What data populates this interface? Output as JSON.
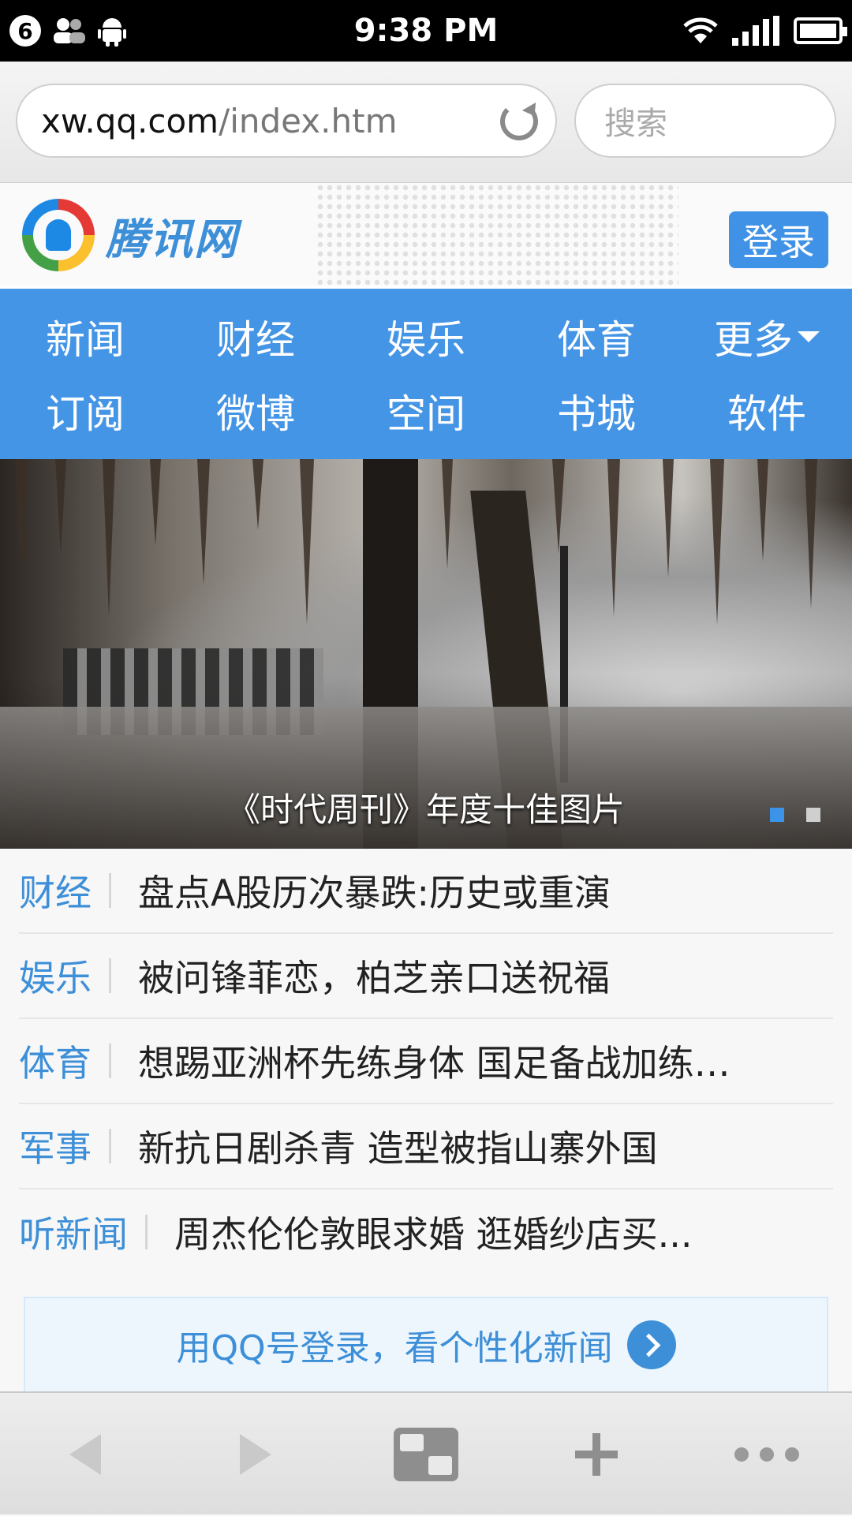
{
  "status_bar": {
    "notification_count": "6",
    "time": "9:38 PM"
  },
  "browser": {
    "url_host": "xw.qq.com",
    "url_path": "/index.htm",
    "search_placeholder": "搜索"
  },
  "site": {
    "logo_text": "腾讯网",
    "login_label": "登录"
  },
  "nav": {
    "row1": [
      "新闻",
      "财经",
      "娱乐",
      "体育",
      "更多"
    ],
    "row2": [
      "订阅",
      "微博",
      "空间",
      "书城",
      "软件"
    ]
  },
  "hero": {
    "caption": "《时代周刊》年度十佳图片",
    "slide_count": 2,
    "active_slide": 1
  },
  "news": [
    {
      "category": "财经",
      "title": "盘点A股历次暴跌:历史或重演"
    },
    {
      "category": "娱乐",
      "title": "被问锋菲恋，柏芝亲口送祝福"
    },
    {
      "category": "体育",
      "title": "想踢亚洲杯先练身体 国足备战加练…"
    },
    {
      "category": "军事",
      "title": "新抗日剧杀青 造型被指山寨外国"
    },
    {
      "category": "听新闻",
      "title": "周杰伦伦敦眼求婚 逛婚纱店买..."
    }
  ],
  "promo": {
    "text": "用QQ号登录，看个性化新闻"
  },
  "toolbar": {
    "icons": [
      "back-icon",
      "forward-icon",
      "tabs-icon",
      "add-icon",
      "more-icon"
    ]
  },
  "colors": {
    "accent": "#4595e6",
    "link": "#3d8fd8"
  }
}
